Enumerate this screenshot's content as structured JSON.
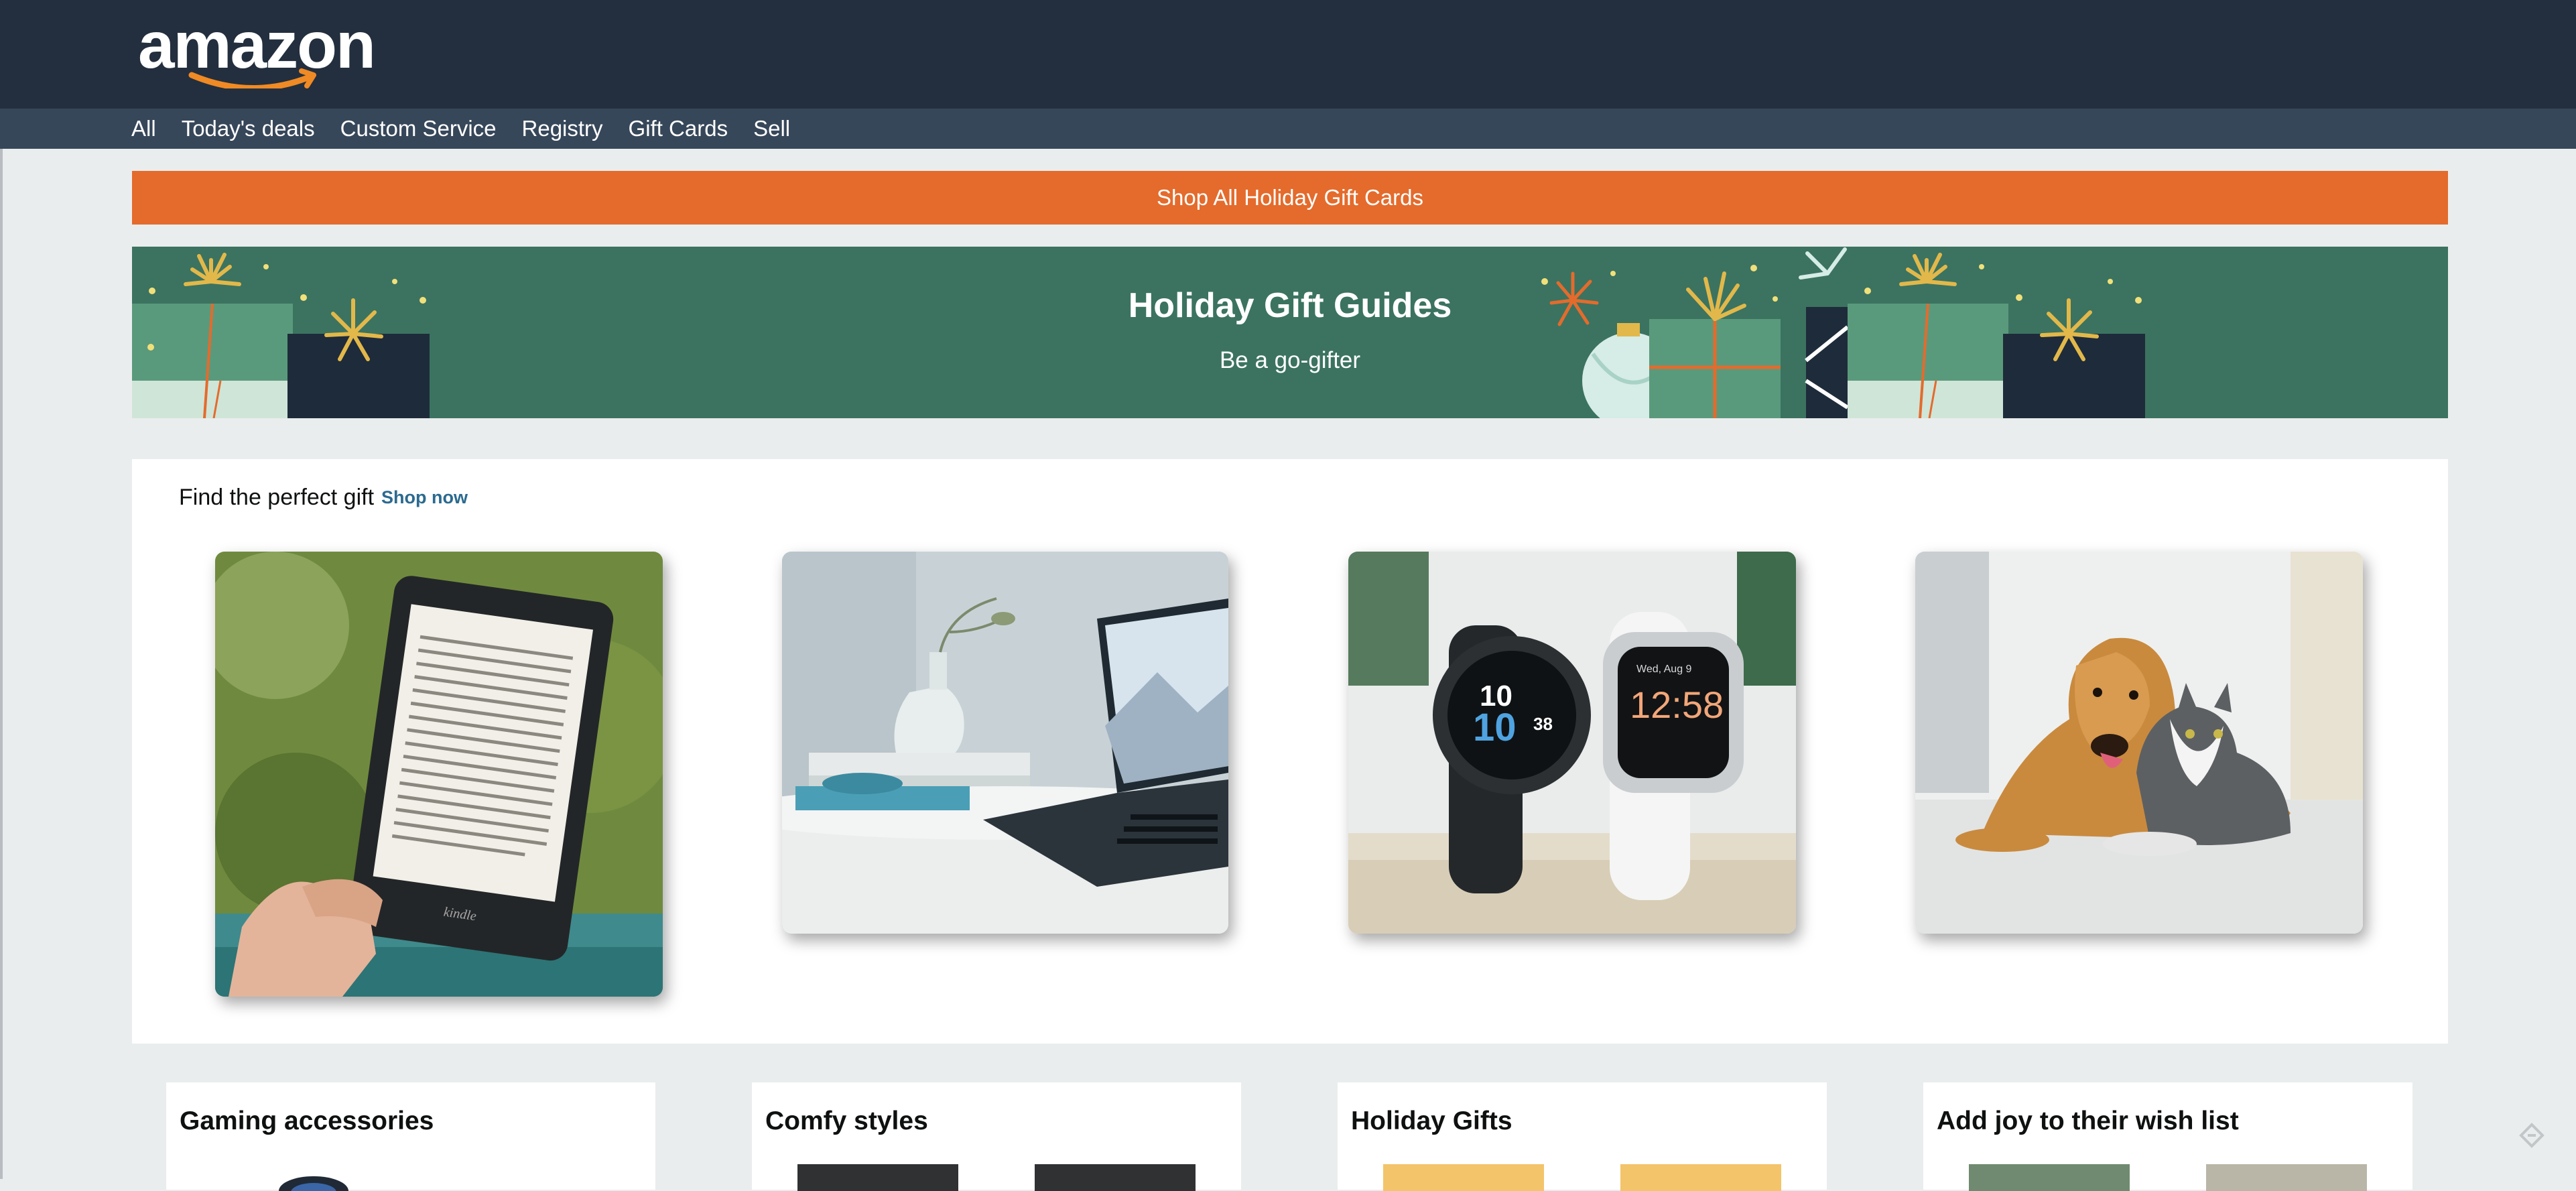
{
  "header": {
    "logo_text": "amazon",
    "nav": [
      "All",
      "Today's deals",
      "Custom Service",
      "Registry",
      "Gift Cards",
      "Sell"
    ]
  },
  "promo": {
    "label": "Shop All Holiday Gift Cards"
  },
  "hero": {
    "title": "Holiday Gift Guides",
    "subtitle": "Be a go-gifter"
  },
  "gift_section": {
    "heading": "Find the perfect gift",
    "link": "Shop now",
    "cards": [
      {
        "name": "kindle-ereader",
        "alt": "Kindle e-reader held by a hand"
      },
      {
        "name": "laptop-on-table",
        "alt": "Laptop on a marble table with a vase"
      },
      {
        "name": "smartwatches",
        "alt": "Black and white smartwatches"
      },
      {
        "name": "dog-and-cat",
        "alt": "Golden retriever and grey cat"
      }
    ]
  },
  "tiles": [
    "Gaming accessories",
    "Comfy styles",
    "Holiday Gifts",
    "Add joy to their wish list"
  ],
  "screen_text": {
    "kindle_brand": "kindle",
    "watch_left_time": "10",
    "watch_left_big": "10",
    "watch_left_small": "38",
    "watch_right_time": "12:58",
    "watch_right_date": "Wed, Aug 9"
  },
  "colors": {
    "header_bg": "#232f3e",
    "nav_bg": "#37475a",
    "promo_bg": "#e46b2c",
    "hero_bg": "#3b7360",
    "link": "#2b6a8f",
    "page_bg": "#eaeded"
  }
}
